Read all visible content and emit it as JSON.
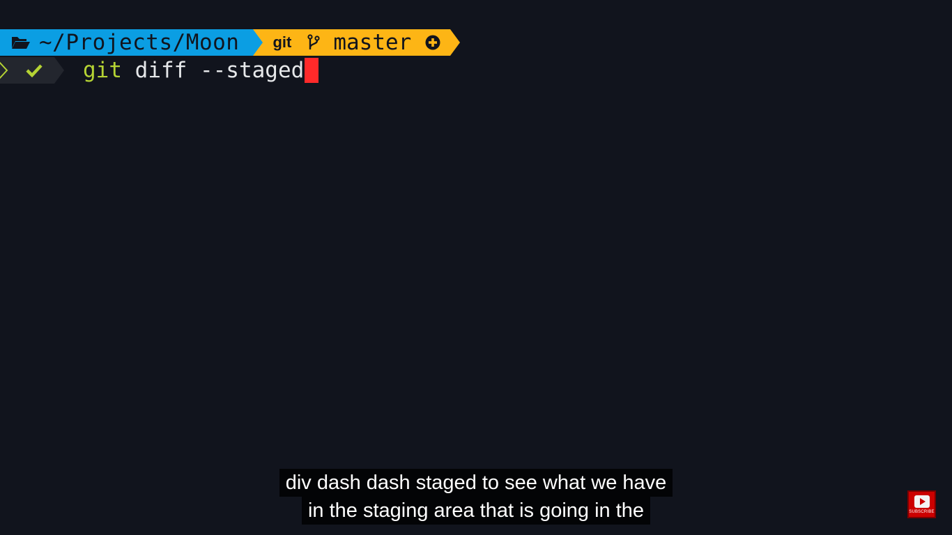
{
  "prompt": {
    "directory": "~/Projects/Moon",
    "directory_icon": "folder-open-icon",
    "vcs_label": "git",
    "branch_icon": "git-branch-icon",
    "branch": "master",
    "status_icon": "plus-circle-icon"
  },
  "line2": {
    "chevron_icon": "chevron-right-icon",
    "status_icon": "check-icon",
    "command_program": "git",
    "command_args": " diff --staged"
  },
  "captions": {
    "line1": "div dash dash staged to see what we have",
    "line2": "in the staging area that is going in the"
  },
  "subscribe": {
    "label": "SUBSCRIBE"
  },
  "colors": {
    "background": "#11141d",
    "dir_segment": "#0b9ee3",
    "git_segment": "#fdb515",
    "command_program": "#b5d334",
    "cursor": "#ff2a2a"
  }
}
